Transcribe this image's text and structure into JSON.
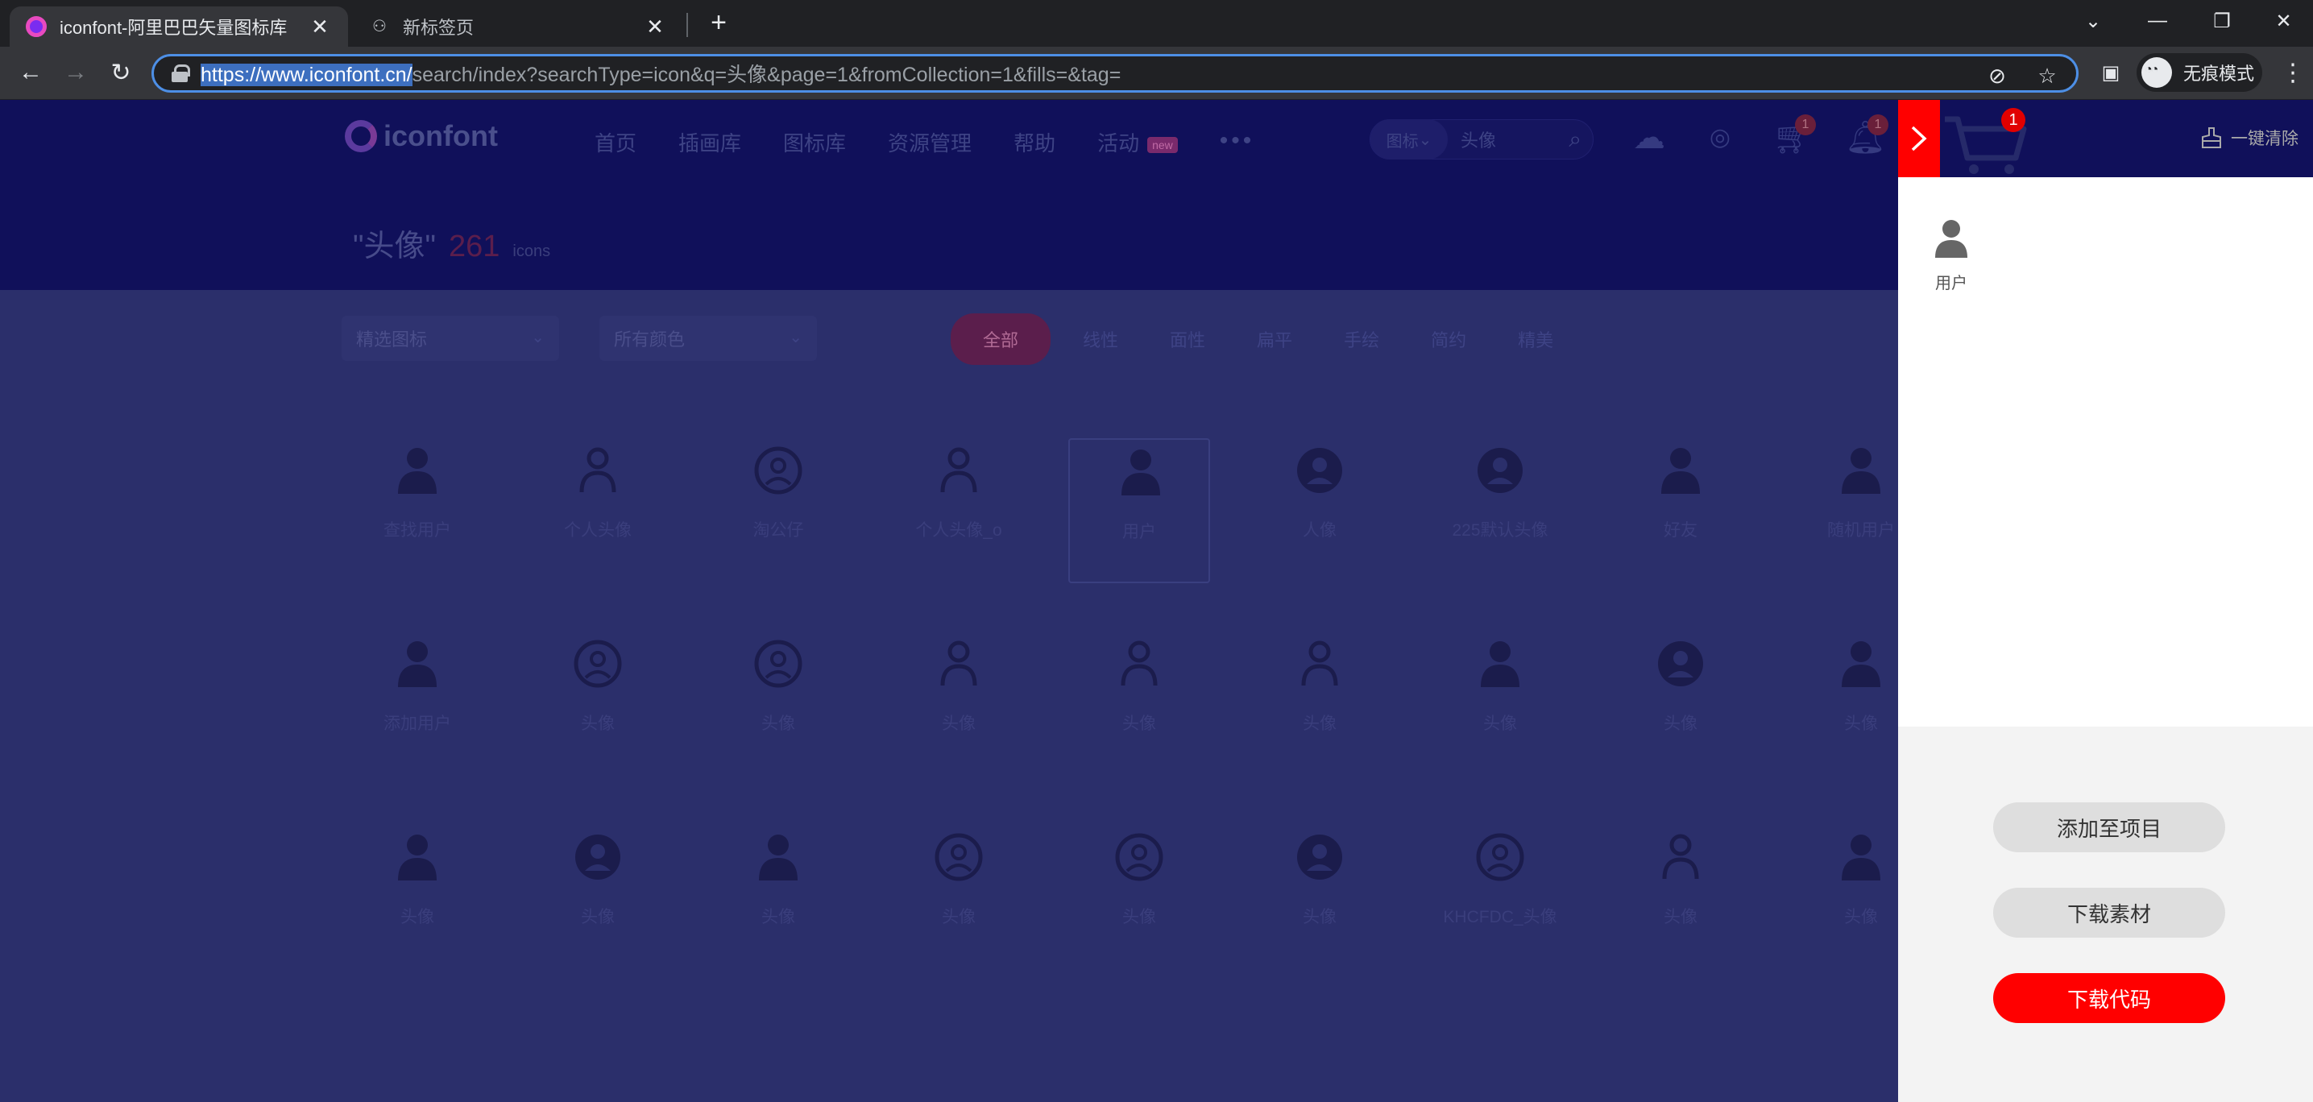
{
  "browser": {
    "tabs": [
      {
        "title": "iconfont-阿里巴巴矢量图标库",
        "active": true
      },
      {
        "title": "新标签页",
        "active": false
      }
    ],
    "url_host": "https://www.iconfont.cn/",
    "url_rest": "search/index?searchType=icon&q=头像&page=1&fromCollection=1&fills=&tag=",
    "incognito_label": "无痕模式"
  },
  "site": {
    "logo_text": "iconfont",
    "nav": [
      "首页",
      "插画库",
      "图标库",
      "资源管理",
      "帮助"
    ],
    "nav_activity": "活动",
    "nav_hot_badge": "new",
    "search_type": "图标",
    "search_query": "头像",
    "cart_count": "1",
    "bell_count": "1",
    "title_query": "\"头像\"",
    "title_count": "261",
    "title_unit": "icons",
    "filter_1": "精选图标",
    "filter_2": "所有颜色",
    "style_pills": [
      "全部",
      "线性",
      "面性",
      "扁平",
      "手绘",
      "简约",
      "精美"
    ],
    "icons_row1": [
      "查找用户",
      "个人头像",
      "淘公仔",
      "个人头像_o",
      "用户",
      "人像",
      "225默认头像",
      "好友",
      "随机用户"
    ],
    "icons_row2": [
      "添加用户",
      "头像",
      "头像",
      "头像",
      "头像",
      "头像",
      "头像",
      "头像",
      "头像"
    ],
    "icons_row3": [
      "头像",
      "头像",
      "头像",
      "头像",
      "头像",
      "头像",
      "KHCFDC_头像",
      "头像",
      "头像"
    ]
  },
  "drawer": {
    "cart_badge": "1",
    "clear_all": "一键清除",
    "items": [
      {
        "name": "用户"
      }
    ],
    "add_to_project": "添加至项目",
    "download_assets": "下载素材",
    "download_code": "下载代码"
  },
  "colors": {
    "accent_red": "#ff0000",
    "omnibox_focus": "#4d8fe6",
    "overlay_bg": "#2b2f6b"
  }
}
